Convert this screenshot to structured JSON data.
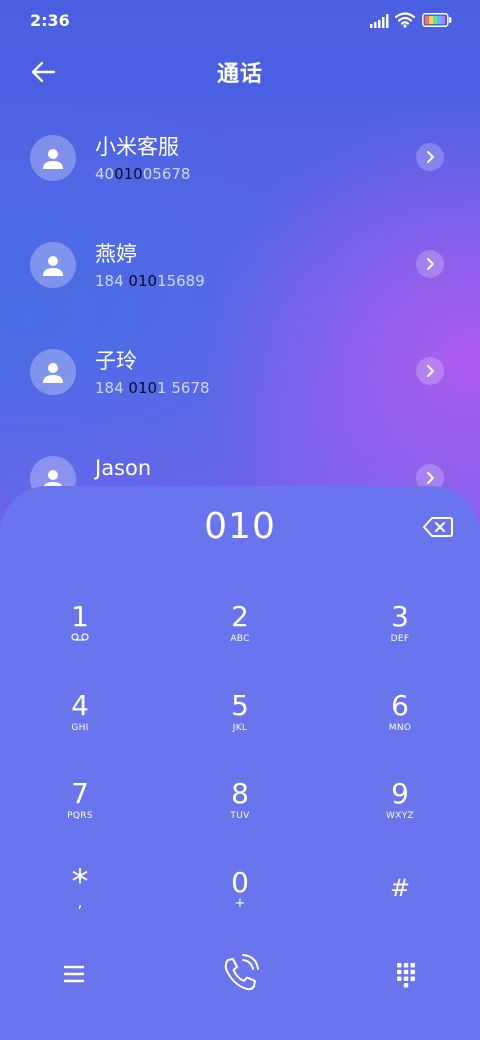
{
  "status_bar": {
    "time": "2:36"
  },
  "header": {
    "title": "通话"
  },
  "contacts": [
    {
      "name": "小米客服",
      "number_pre": "40",
      "number_match": "010",
      "number_post": "05678"
    },
    {
      "name": "燕婷",
      "number_pre": "184 ",
      "number_match": "010",
      "number_post": "15689"
    },
    {
      "name": "子玲",
      "number_pre": "184 ",
      "number_match": "010",
      "number_post": "1 5678"
    },
    {
      "name": "Jason",
      "number_pre": "",
      "number_match": "",
      "number_post": ""
    }
  ],
  "dialer": {
    "number": "010",
    "keys": [
      {
        "digit": "1",
        "letters": ""
      },
      {
        "digit": "2",
        "letters": "ABC"
      },
      {
        "digit": "3",
        "letters": "DEF"
      },
      {
        "digit": "4",
        "letters": "GHI"
      },
      {
        "digit": "5",
        "letters": "JKL"
      },
      {
        "digit": "6",
        "letters": "MNO"
      },
      {
        "digit": "7",
        "letters": "PQRS"
      },
      {
        "digit": "8",
        "letters": "TUV"
      },
      {
        "digit": "9",
        "letters": "WXYZ"
      },
      {
        "digit": "*",
        "letters": ","
      },
      {
        "digit": "0",
        "letters": "+"
      },
      {
        "digit": "#",
        "letters": ""
      }
    ]
  },
  "icons": {
    "back": "arrow-left-icon",
    "backspace": "backspace-icon",
    "voicemail": "voicemail-icon",
    "menu": "menu-icon",
    "call": "call-icon",
    "keypad": "keypad-icon"
  },
  "colors": {
    "header": "#4b5fe2",
    "dial_sheet": "#6a74ed",
    "match_highlight": "#0c0c24"
  }
}
